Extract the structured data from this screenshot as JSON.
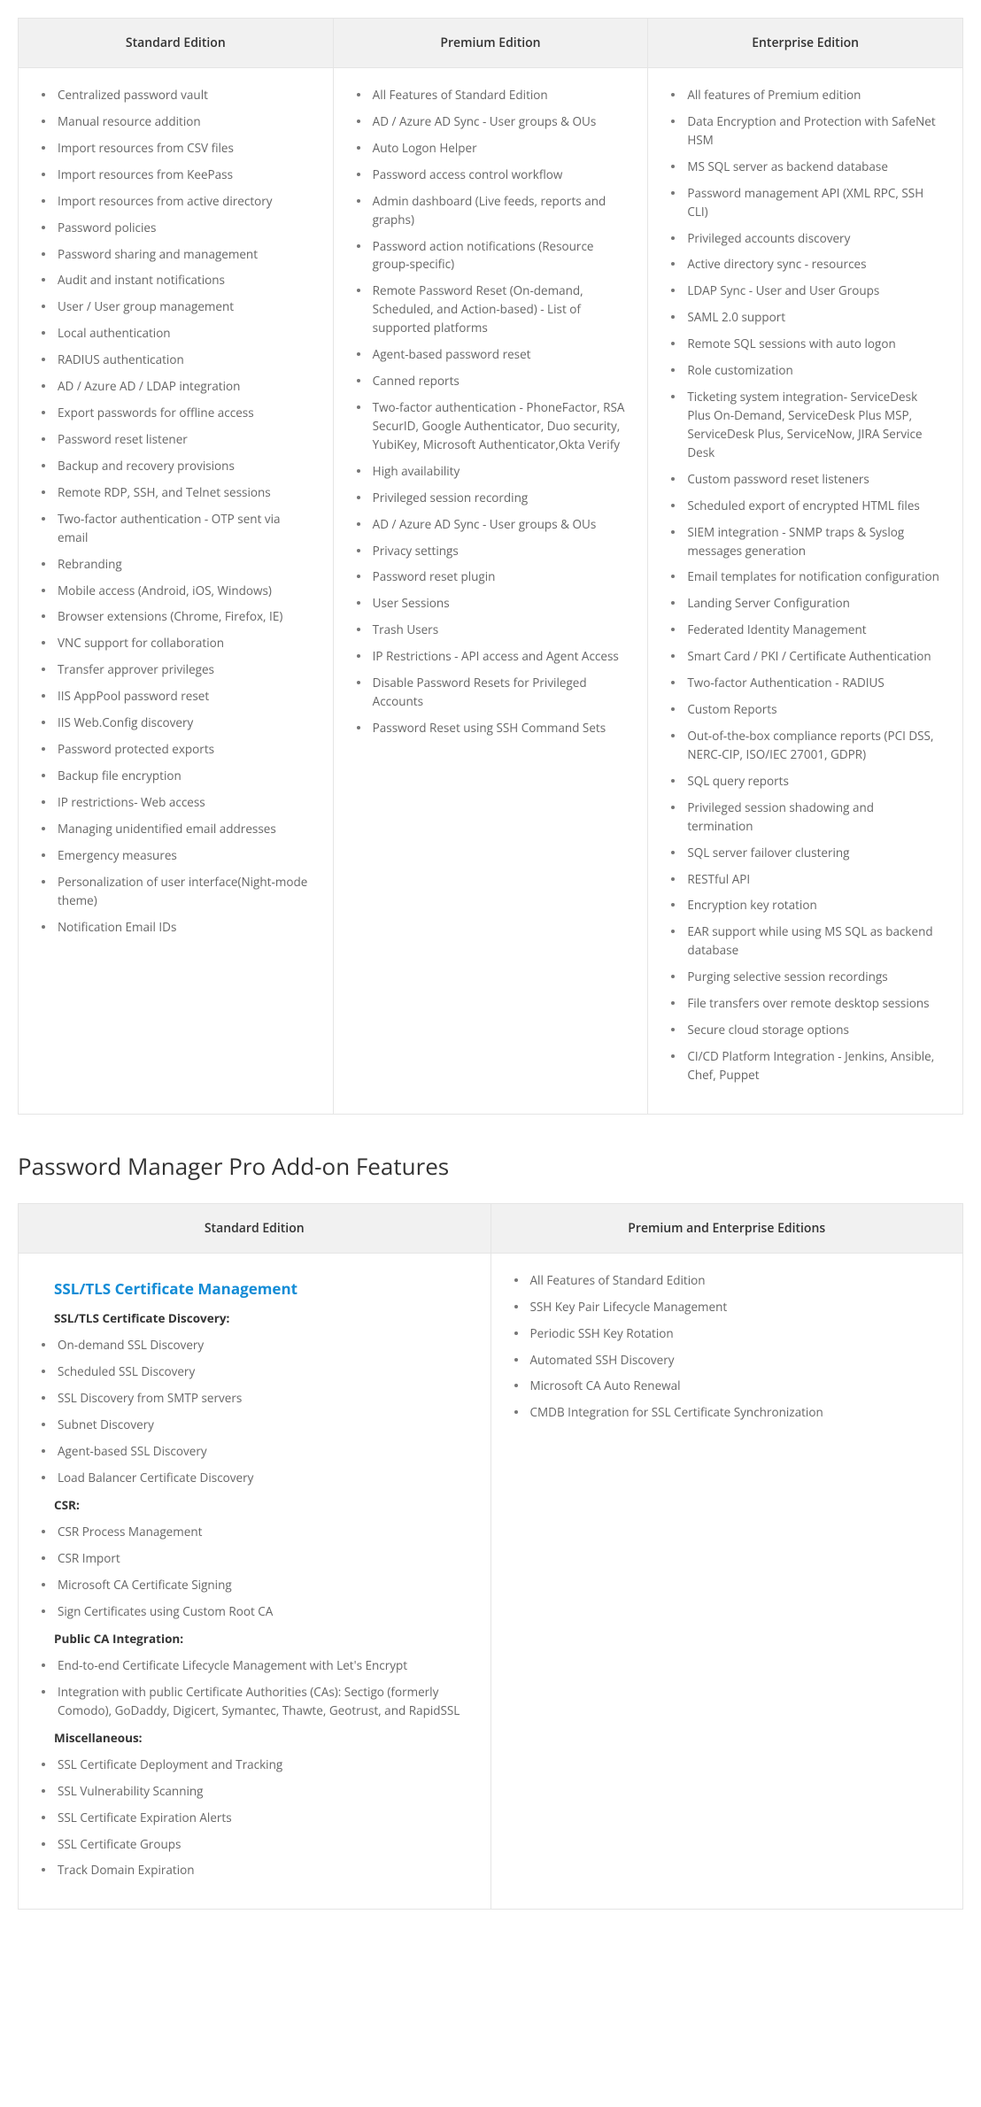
{
  "editions": {
    "headers": [
      "Standard Edition",
      "Premium Edition",
      "Enterprise Edition"
    ],
    "standard": [
      "Centralized password vault",
      "Manual resource addition",
      "Import resources from CSV files",
      "Import resources from KeePass",
      "Import resources from active directory",
      "Password policies",
      "Password sharing and management",
      "Audit and instant notifications",
      "User / User group management",
      "Local authentication",
      "RADIUS authentication",
      "AD / Azure AD / LDAP integration",
      "Export passwords for offline access",
      "Password reset listener",
      "Backup and recovery provisions",
      "Remote RDP, SSH, and Telnet sessions",
      "Two-factor authentication - OTP sent via email",
      "Rebranding",
      "Mobile access (Android, iOS, Windows)",
      "Browser extensions (Chrome, Firefox, IE)",
      "VNC support for collaboration",
      "Transfer approver privileges",
      "IIS AppPool password reset",
      "IIS Web.Config discovery",
      "Password protected exports",
      "Backup file encryption",
      "IP restrictions- Web access",
      "Managing unidentified email addresses",
      "Emergency measures",
      "Personalization of user interface(Night-mode theme)",
      "Notification Email IDs"
    ],
    "premium": [
      "All Features of Standard Edition",
      "AD / Azure AD Sync - User groups & OUs",
      "Auto Logon Helper",
      "Password access control workflow",
      "Admin dashboard (Live feeds, reports and graphs)",
      "Password action notifications (Resource group-specific)",
      "Remote Password Reset (On-demand, Scheduled, and Action-based) - List of supported platforms",
      "Agent-based password reset",
      "Canned reports",
      "Two-factor authentication - PhoneFactor, RSA SecurID, Google Authenticator, Duo security, YubiKey, Microsoft Authenticator,Okta Verify",
      "High availability",
      "Privileged session recording",
      "AD / Azure AD Sync - User groups & OUs",
      "Privacy settings",
      "Password reset plugin",
      "User Sessions",
      "Trash Users",
      "IP Restrictions - API access and Agent Access",
      "Disable Password Resets for Privileged Accounts",
      "Password Reset using SSH Command Sets"
    ],
    "enterprise": [
      "All features of Premium edition",
      "Data Encryption and Protection with SafeNet HSM",
      "MS SQL server as backend database",
      "Password management API (XML RPC, SSH CLI)",
      "Privileged accounts discovery",
      "Active directory sync - resources",
      "LDAP Sync - User and User Groups",
      "SAML 2.0 support",
      "Remote SQL sessions with auto logon",
      "Role customization",
      "Ticketing system integration- ServiceDesk Plus On-Demand, ServiceDesk Plus MSP, ServiceDesk Plus, ServiceNow, JIRA Service Desk",
      "Custom password reset listeners",
      "Scheduled export of encrypted HTML files",
      "SIEM integration - SNMP traps & Syslog messages generation",
      "Email templates for notification configuration",
      "Landing Server Configuration",
      "Federated Identity Management",
      "Smart Card / PKI / Certificate Authentication",
      "Two-factor Authentication - RADIUS",
      "Custom Reports",
      "Out-of-the-box compliance reports (PCI DSS, NERC-CIP, ISO/IEC 27001, GDPR)",
      "SQL query reports",
      "Privileged session shadowing and termination",
      "SQL server failover clustering",
      "RESTful API",
      "Encryption key rotation",
      "EAR support while using MS SQL as backend database",
      "Purging selective session recordings",
      "File transfers over remote desktop sessions",
      "Secure cloud storage options",
      "CI/CD Platform Integration - Jenkins, Ansible, Chef, Puppet"
    ]
  },
  "addon": {
    "heading": "Password Manager Pro Add-on Features",
    "headers": [
      "Standard Edition",
      "Premium and Enterprise Editions"
    ],
    "standard": {
      "title": "SSL/TLS Certificate Management",
      "groups": [
        {
          "label": "SSL/TLS Certificate Discovery:",
          "items": [
            "On-demand SSL Discovery",
            "Scheduled SSL Discovery",
            "SSL Discovery from SMTP servers",
            "Subnet Discovery",
            "Agent-based SSL Discovery",
            "Load Balancer Certificate Discovery"
          ]
        },
        {
          "label": "CSR:",
          "items": [
            "CSR Process Management",
            "CSR Import",
            "Microsoft CA Certificate Signing",
            "Sign Certificates using Custom Root CA"
          ]
        },
        {
          "label": "Public CA Integration:",
          "items": [
            "End-to-end Certificate Lifecycle Management with Let's Encrypt",
            "Integration with public Certificate Authorities (CAs): Sectigo (formerly Comodo), GoDaddy, Digicert, Symantec, Thawte, Geotrust, and RapidSSL"
          ]
        },
        {
          "label": "Miscellaneous:",
          "items": [
            "SSL Certificate Deployment and Tracking",
            "SSL Vulnerability Scanning",
            "SSL Certificate Expiration Alerts",
            "SSL Certificate Groups",
            "Track Domain Expiration"
          ]
        }
      ]
    },
    "premium_enterprise": [
      "All Features of Standard Edition",
      "SSH Key Pair Lifecycle Management",
      "Periodic SSH Key Rotation",
      "Automated SSH Discovery",
      "Microsoft CA Auto Renewal",
      "CMDB Integration for SSL Certificate Synchronization"
    ]
  }
}
